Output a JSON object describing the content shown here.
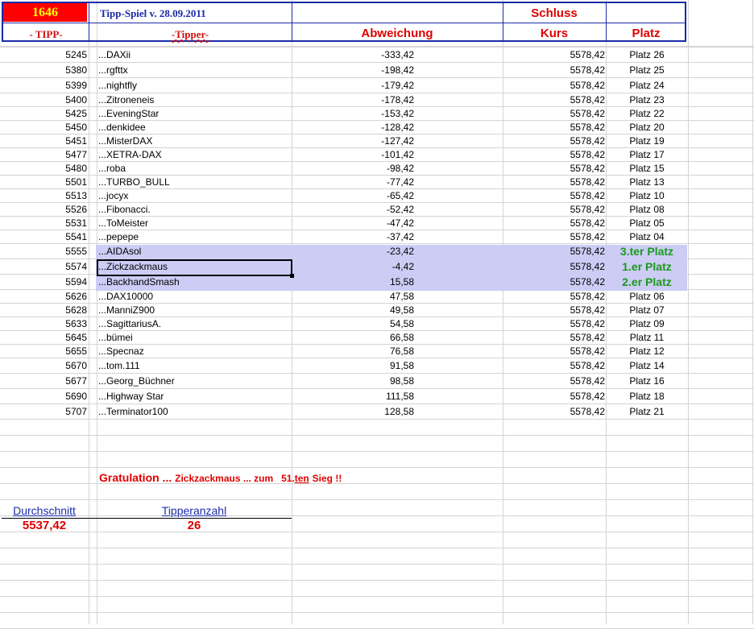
{
  "header": {
    "count": "1646",
    "title": "Tipp-Spiel v. 28.09.2011",
    "schluss": "Schluss",
    "col_tipp": "- TIPP-",
    "col_tipper": "-Tipper-",
    "col_abweichung": "Abweichung",
    "col_kurs": "Kurs",
    "col_platz": "Platz"
  },
  "rows": [
    {
      "tipp": "5245",
      "tipper": "...DAXii",
      "abw": "-333,42",
      "kurs": "5578,42",
      "platz": "Platz 26"
    },
    {
      "tipp": "5380",
      "tipper": "...rgfttx",
      "abw": "-198,42",
      "kurs": "5578,42",
      "platz": "Platz 25"
    },
    {
      "tipp": "5399",
      "tipper": "...nightfly",
      "abw": "-179,42",
      "kurs": "5578,42",
      "platz": "Platz 24"
    },
    {
      "tipp": "5400",
      "tipper": "...Zitroneneis",
      "abw": "-178,42",
      "kurs": "5578,42",
      "platz": "Platz 23"
    },
    {
      "tipp": "5425",
      "tipper": "...EveningStar",
      "abw": "-153,42",
      "kurs": "5578,42",
      "platz": "Platz 22"
    },
    {
      "tipp": "5450",
      "tipper": "...denkidee",
      "abw": "-128,42",
      "kurs": "5578,42",
      "platz": "Platz 20"
    },
    {
      "tipp": "5451",
      "tipper": "...MisterDAX",
      "abw": "-127,42",
      "kurs": "5578,42",
      "platz": "Platz 19"
    },
    {
      "tipp": "5477",
      "tipper": "...XETRA-DAX",
      "abw": "-101,42",
      "kurs": "5578,42",
      "platz": "Platz 17"
    },
    {
      "tipp": "5480",
      "tipper": "...roba",
      "abw": "-98,42",
      "kurs": "5578,42",
      "platz": "Platz 15"
    },
    {
      "tipp": "5501",
      "tipper": "...TURBO_BULL",
      "abw": "-77,42",
      "kurs": "5578,42",
      "platz": "Platz 13"
    },
    {
      "tipp": "5513",
      "tipper": "...jocyx",
      "abw": "-65,42",
      "kurs": "5578,42",
      "platz": "Platz 10"
    },
    {
      "tipp": "5526",
      "tipper": "...Fibonacci.",
      "abw": "-52,42",
      "kurs": "5578,42",
      "platz": "Platz 08"
    },
    {
      "tipp": "5531",
      "tipper": "...ToMeister",
      "abw": "-47,42",
      "kurs": "5578,42",
      "platz": "Platz 05"
    },
    {
      "tipp": "5541",
      "tipper": "...pepepe",
      "abw": "-37,42",
      "kurs": "5578,42",
      "platz": "Platz 04"
    },
    {
      "tipp": "5555",
      "tipper": "...AIDAsol",
      "abw": "-23,42",
      "kurs": "5578,42",
      "platz": "3.ter Platz"
    },
    {
      "tipp": "5574",
      "tipper": "...Zickzackmaus",
      "abw": "-4,42",
      "kurs": "5578,42",
      "platz": "1.er Platz"
    },
    {
      "tipp": "5594",
      "tipper": "...BackhandSmash",
      "abw": "15,58",
      "kurs": "5578,42",
      "platz": "2.er Platz"
    },
    {
      "tipp": "5626",
      "tipper": "...DAX10000",
      "abw": "47,58",
      "kurs": "5578,42",
      "platz": "Platz 06"
    },
    {
      "tipp": "5628",
      "tipper": "...ManniZ900",
      "abw": "49,58",
      "kurs": "5578,42",
      "platz": "Platz 07"
    },
    {
      "tipp": "5633",
      "tipper": "...SagittariusA.",
      "abw": "54,58",
      "kurs": "5578,42",
      "platz": "Platz 09"
    },
    {
      "tipp": "5645",
      "tipper": "...bümei",
      "abw": "66,58",
      "kurs": "5578,42",
      "platz": "Platz 11"
    },
    {
      "tipp": "5655",
      "tipper": "...Specnaz",
      "abw": "76,58",
      "kurs": "5578,42",
      "platz": "Platz 12"
    },
    {
      "tipp": "5670",
      "tipper": "...tom.111",
      "abw": "91,58",
      "kurs": "5578,42",
      "platz": "Platz 14"
    },
    {
      "tipp": "5677",
      "tipper": "...Georg_Büchner",
      "abw": "98,58",
      "kurs": "5578,42",
      "platz": "Platz 16"
    },
    {
      "tipp": "5690",
      "tipper": "...Highway Star",
      "abw": "111,58",
      "kurs": "5578,42",
      "platz": "Platz 18"
    },
    {
      "tipp": "5707",
      "tipper": "...Terminator100",
      "abw": "128,58",
      "kurs": "5578,42",
      "platz": "Platz 21"
    }
  ],
  "congrats": {
    "prefix": "Gratulation ...",
    "name_part": "Zickzackmaus ... zum",
    "count_prefix": "51.",
    "count_ul": "ten",
    "suffix": "Sieg !!"
  },
  "summary": {
    "avg_label": "Durchschnitt",
    "avg_value": "5537,42",
    "count_label": "Tipperanzahl",
    "count_value": "26"
  },
  "colors": {
    "header_border": "#1a2aa8",
    "highlight_band": "#ccccf5",
    "podium_green": "#1a9a1a",
    "accent_red": "#e00000"
  }
}
